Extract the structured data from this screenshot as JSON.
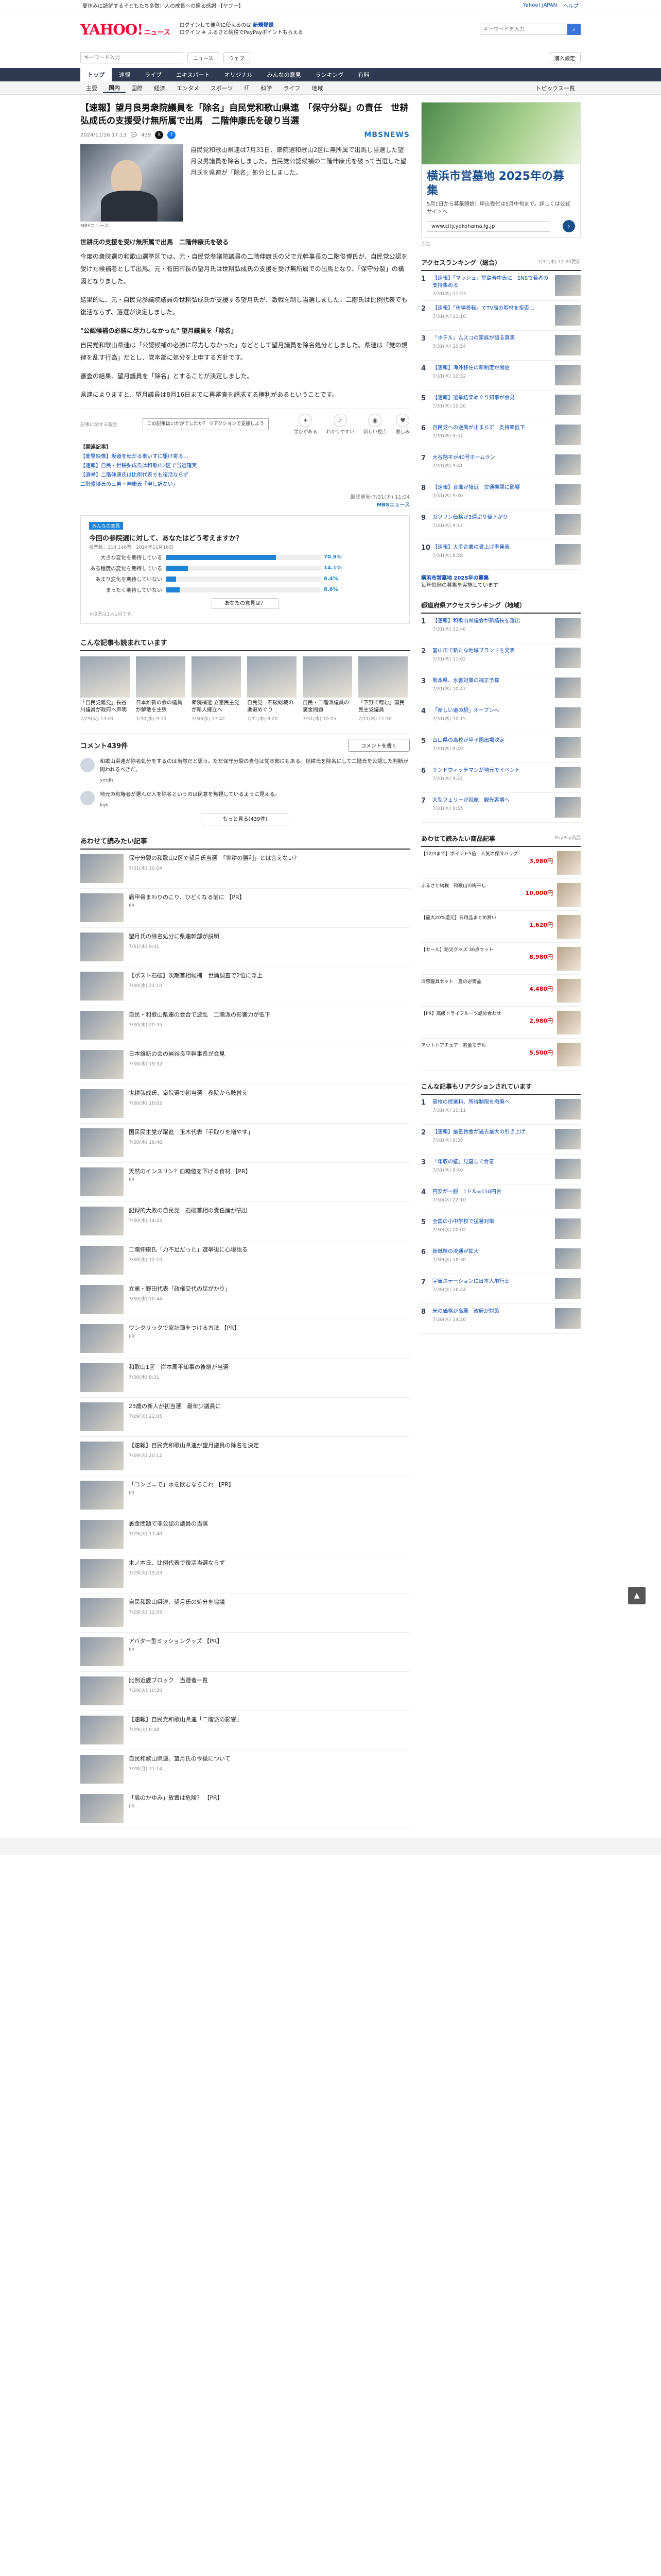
{
  "topbar": {
    "notice": "夏休みに読解する子どもたち多数！人の成長への贈る感謝 【ヤフー】",
    "links": [
      "Yahoo! JAPAN",
      "ヘルプ"
    ]
  },
  "header": {
    "logo": "YAHOO!",
    "logo_sub": "ニュース",
    "promo_line1": "ログインして便利に使えるのは",
    "promo_link": "新規登録",
    "promo_line2": "ログイン ※ ふるさと納税でPayPayポイントもらえる",
    "search_placeholder": "キーワードを入力",
    "search_icon": "search-icon"
  },
  "searchrow": {
    "placeholder": "キーワード入力",
    "buttons": [
      "ニュース",
      "ウェブ",
      "購入設定"
    ]
  },
  "gnav": [
    "トップ",
    "速報",
    "ライブ",
    "エキスパート",
    "オリジナル",
    "みんなの意見",
    "ランキング",
    "有料"
  ],
  "gnav_active": "トップ",
  "snav": [
    "主要",
    "国内",
    "国際",
    "経済",
    "エンタメ",
    "スポーツ",
    "IT",
    "科学",
    "ライフ",
    "地域"
  ],
  "snav_active": "国内",
  "snav_right": "トピックス一覧",
  "article": {
    "title": "【速報】望月良男衆院議員を「除名」自民党和歌山県連　「保守分裂」の責任　世耕弘成氏の支援受け無所属で出馬　二階伸康氏を破り当選",
    "date": "2024/11/16 17:13",
    "comments": "439",
    "source_logo": "MBS",
    "source_logo2": "NEWS",
    "photo_caption": "MBSニュース",
    "lead": "自民党和歌山県連は7月31日、衆院選和歌山2区に無所属で出馬し当選した望月良男議員を除名しました。自民党公認候補の二階伸康氏を破って当選した望月氏を県連が「除名」処分としました。",
    "paragraphs": [
      "世耕氏の支援を受け無所属で出馬　二階伸康氏を破る",
      "今度の衆院選の和歌山選挙区では、元・自民党参議院議員の二階伸康氏の父で元幹事長の二階俊博氏が、自民党公認を受けた候補者として出馬。元・有田市長の望月氏は世耕弘成氏の支援を受け無所属での出馬となり、「保守分裂」の構図となりました。",
      "結果的に、元・自民党参議院議員の世耕弘成氏が支援する望月氏が、激戦を制し当選しました。二階氏は比例代表でも復活ならず、落選が決定しました。",
      "\"公認候補の必勝に尽力しなかった\" 望月議員を「除名」",
      "自民党和歌山県連は「公認候補の必勝に尽力しなかった」などとして望月議員を除名処分としました。県連は「党の規律を乱す行為」だとし、党本部に処分を上申する方針です。",
      "審査の結果、望月議員を「除名」とすることが決定しました。",
      "県連によりますと、望月議員は8月16日までに再審査を請求する権利があるということです。"
    ],
    "tip": "この記事はいかがでしたか？ リアクションで支援しよう",
    "reactions": [
      {
        "label": "学びがある",
        "icon": "lightbulb-icon",
        "glyph": "✦"
      },
      {
        "label": "わかりやすい",
        "icon": "check-icon",
        "glyph": "✓"
      },
      {
        "label": "新しい視点",
        "icon": "eye-icon",
        "glyph": "◉"
      },
      {
        "label": "悲しみ",
        "icon": "heart-icon",
        "glyph": "♥"
      }
    ],
    "report": "記事に関する報告",
    "related_head": "【関連記事】",
    "related": [
      "【衝撃映像】坂道を転がる車いすに駆け寄る…",
      "【速報】自民・世耕弘成氏は和歌山2区で当選確実",
      "【選挙】二階伸康氏は比例代表でも復活ならず",
      "二階俊博氏の三男・伸康氏「申し訳ない」"
    ],
    "credit": "最終更新:7/31(木) 11:04",
    "credit2": "MBSニュース"
  },
  "poll": {
    "tag": "みんなの意見",
    "question": "今回の参院選に対して、あなたはどう考えますか？",
    "sub": "投票数：114,146票　2024年11月16日",
    "options": [
      {
        "label": "大きな変化を期待している",
        "pct": 70.9
      },
      {
        "label": "ある程度の変化を期待している",
        "pct": 14.1
      },
      {
        "label": "あまり変化を期待していない",
        "pct": 6.4
      },
      {
        "label": "まったく期待していない",
        "pct": 8.6
      }
    ],
    "more": "あなたの意見は？",
    "foot": "※投票は1人1回です。"
  },
  "recommend": {
    "head": "こんな記事も読まれています",
    "cards": [
      {
        "title": "「自民党離党」長谷川議員が政府へ声明",
        "date": "7/29(火) 13:01"
      },
      {
        "title": "日本維新の会の議員が解散を主張",
        "date": "7/30(水) 9:15"
      },
      {
        "title": "衆院補選 立憲民主党が新人擁立へ",
        "date": "7/30(水) 17:42"
      },
      {
        "title": "自民党　石破総裁の進退めぐり",
        "date": "7/31(木) 8:20"
      },
      {
        "title": "自民・二階派議員の裏金問題",
        "date": "7/31(木) 10:05"
      },
      {
        "title": "「下野で臨む」国民民主党議員",
        "date": "7/31(木) 11:30"
      }
    ]
  },
  "comments": {
    "head": "コメント439件",
    "write": "コメントを書く",
    "items": [
      {
        "text": "和歌山県連が除名処分をするのは当然だと思う。ただ保守分裂の責任は党本部にもある。世耕氏を除名にして二階氏を公認した判断が問われるべきだ。",
        "name": "ymdh"
      },
      {
        "text": "地元の有権者が選んだ人を除名というのは民意を無視しているように見える。",
        "name": "kgk"
      }
    ],
    "more": "もっと見る(439件)"
  },
  "alsoread": {
    "head": "あわせて読みたい記事",
    "items": [
      {
        "text": "保守分裂の和歌山2区で望月氏当選　「世耕の勝利」とは言えない？",
        "date": "7/31(木) 10:04",
        "ad": false
      },
      {
        "text": "肩甲骨まわりのこり、ひどくなる前に 【PR】",
        "date": "PR",
        "ad": true
      },
      {
        "text": "望月氏の除名処分に県連幹部が説明",
        "date": "7/31(木) 9:41",
        "ad": false
      },
      {
        "text": "【ポスト石破】次期首相候補　世論調査で2位に浮上",
        "date": "7/30(水) 22:10",
        "ad": false
      },
      {
        "text": "自民・和歌山県連の会合で波乱　二階派の影響力が低下",
        "date": "7/30(水) 20:55",
        "ad": false
      },
      {
        "text": "日本維新の会の岩谷良平幹事長が会見",
        "date": "7/30(水) 19:32",
        "ad": false
      },
      {
        "text": "世耕弘成氏、衆院選で初当選　参院から鞍替え",
        "date": "7/30(水) 18:02",
        "ad": false
      },
      {
        "text": "国民民主党が躍進　玉木代表「手取りを増やす」",
        "date": "7/30(水) 16:48",
        "ad": false
      },
      {
        "text": "天然のインスリン？血糖値を下げる食材 【PR】",
        "date": "PR",
        "ad": true
      },
      {
        "text": "記録的大敗の自民党　石破首相の責任論が噴出",
        "date": "7/30(水) 14:22",
        "ad": false
      },
      {
        "text": "二階伸康氏「力不足だった」選挙後に心境語る",
        "date": "7/30(水) 12:10",
        "ad": false
      },
      {
        "text": "立憲・野田代表「政権交代の足がかり」",
        "date": "7/30(水) 10:44",
        "ad": false
      },
      {
        "text": "ワンクリックで家計簿をつける方法 【PR】",
        "date": "PR",
        "ad": true
      },
      {
        "text": "和歌山1区　岸本周平知事の後継が当選",
        "date": "7/30(水) 8:31",
        "ad": false
      },
      {
        "text": "23歳の新人が初当選　最年少議員に",
        "date": "7/29(火) 22:05",
        "ad": false
      },
      {
        "text": "【速報】自民党和歌山県連が望月議員の除名を決定",
        "date": "7/29(火) 20:12",
        "ad": false
      },
      {
        "text": "「コンビニで」水を飲むならこれ 【PR】",
        "date": "PR",
        "ad": true
      },
      {
        "text": "裏金問題で非公認の議員の当落",
        "date": "7/29(火) 17:40",
        "ad": false
      },
      {
        "text": "木ノ本氏、比例代表で復活当選ならず",
        "date": "7/29(火) 15:03",
        "ad": false
      },
      {
        "text": "自民和歌山県連、望月氏の処分を協議",
        "date": "7/29(火) 12:55",
        "ad": false
      },
      {
        "text": "アバター型ミッショングッズ 【PR】",
        "date": "PR",
        "ad": true
      },
      {
        "text": "比例近畿ブロック　当選者一覧",
        "date": "7/29(火) 10:20",
        "ad": false
      },
      {
        "text": "【速報】自民党和歌山県連「二階派の影響」",
        "date": "7/29(火) 8:48",
        "ad": false
      },
      {
        "text": "自民和歌山県連、望月氏の今後について",
        "date": "7/28(月) 21:14",
        "ad": false
      },
      {
        "text": "「肩のかゆみ」放置は危険？ 【PR】",
        "date": "PR",
        "ad": true
      }
    ]
  },
  "side": {
    "ad_title": "横浜市営墓地 2025年の募集",
    "ad_sub": "5月1日から募集開始！申込受付は5月中旬まで。詳しくは公式サイトへ",
    "ad_url": "www.city.yokohama.lg.jp",
    "ad_tag": "広告",
    "rank_head": "アクセスランキング（総合）",
    "rank_note": "7/31(木) 12:20更新",
    "ranking": [
      {
        "text": "【速報】「マッシュ」堂島寿中氏に　SNSで若者の支持集める",
        "date": "7/31(木) 11:53"
      },
      {
        "text": "【速報】「市場移転」でTV局の取材を拒否…",
        "date": "7/31(木) 11:10"
      },
      {
        "text": "「ホテル」ムスコの家族が語る真実",
        "date": "7/31(木) 10:54"
      },
      {
        "text": "【速報】海外移住の新制度が開始",
        "date": "7/31(木) 10:32"
      },
      {
        "text": "【速報】選挙結果めぐり知事が会見",
        "date": "7/31(木) 10:20"
      },
      {
        "text": "自民党への逆風が止まらず　支持率低下",
        "date": "7/31(木) 9:57"
      },
      {
        "text": "大谷翔平が40号ホームラン",
        "date": "7/31(木) 9:41"
      },
      {
        "text": "【速報】台風が接近　交通機関に影響",
        "date": "7/31(木) 9:30"
      },
      {
        "text": "ガソリン価格が3週ぶり値下がり",
        "date": "7/31(木) 9:12"
      },
      {
        "text": "【速報】大手企業の賃上げ率発表",
        "date": "7/31(木) 8:58"
      }
    ],
    "pr_text": "横浜市営墓地 2025年の募集",
    "pr_sub": "毎年恒例の募集を実施しています",
    "local_head": "都道府県アクセスランキング（地域）",
    "local": [
      {
        "text": "【速報】和歌山県議会が新議長を選出",
        "date": "7/31(木) 11:40"
      },
      {
        "text": "富山市で新たな地域ブランドを発表",
        "date": "7/31(木) 11:02"
      },
      {
        "text": "熊本県、水害対策の補正予算",
        "date": "7/31(木) 10:47"
      },
      {
        "text": "「新しい道の駅」オープンへ",
        "date": "7/31(木) 10:15"
      },
      {
        "text": "山口県の高校が甲子園出場決定",
        "date": "7/31(木) 9:49"
      },
      {
        "text": "サンドウィッチマンが地元でイベント",
        "date": "7/31(木) 9:22"
      },
      {
        "text": "大型フェリーが就航　観光客増へ",
        "date": "7/31(木) 8:55"
      }
    ],
    "shop_head": "あわせて読みたい商品記事",
    "shop_sub": "PayPay商品",
    "shops": [
      {
        "text": "【12/3まで】ポイント5倍　人気の保冷バッグ",
        "price": "3,980円"
      },
      {
        "text": "ふるさと納税　和歌山の梅干し",
        "price": "10,000円"
      },
      {
        "text": "【最大20%還元】日用品まとめ買い",
        "price": "1,620円"
      },
      {
        "text": "【セール】防災グッズ 30点セット",
        "price": "8,980円"
      },
      {
        "text": "冷感寝具セット　夏の必需品",
        "price": "4,480円"
      },
      {
        "text": "【PR】高級ドライフルーツ詰め合わせ",
        "price": "2,980円"
      },
      {
        "text": "アウトドアチェア　軽量モデル",
        "price": "5,500円"
      }
    ],
    "reco_head": "こんな記事もリアクションされています",
    "reco": [
      {
        "text": "高校の授業料、所得制限を撤廃へ",
        "date": "7/31(木) 10:11"
      },
      {
        "text": "【速報】最低賃金が過去最大の引き上げ",
        "date": "7/31(木) 9:35"
      },
      {
        "text": "「年収の壁」見直しで合意",
        "date": "7/31(木) 8:40"
      },
      {
        "text": "円安が一服　1ドル=150円台",
        "date": "7/30(水) 22:10"
      },
      {
        "text": "全国の小中学校で猛暑対策",
        "date": "7/30(水) 20:02"
      },
      {
        "text": "新紙幣の流通が拡大",
        "date": "7/30(水) 18:30"
      },
      {
        "text": "宇宙ステーションに日本人飛行士",
        "date": "7/30(水) 16:44"
      },
      {
        "text": "米の価格が高騰　政府が対策",
        "date": "7/30(水) 14:20"
      }
    ]
  },
  "pagetop": "▲"
}
